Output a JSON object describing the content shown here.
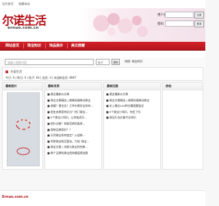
{
  "topbar": {
    "links": [
      "设为首页",
      "收藏本站"
    ]
  },
  "logo": {
    "title": "尔诺生活",
    "domain": "ernuo.com.cn"
  },
  "login": {
    "username_label": "用户名",
    "password_label": "密码",
    "register_label": "注册",
    "login_label": "登录"
  },
  "nav": {
    "items": [
      "网站首页",
      "珠宝知识",
      "饰品展示",
      "美文辞藏"
    ]
  },
  "search": {
    "placeholder": "请输入搜索内容",
    "scope": "帖子",
    "button": "搜索",
    "hot": "热搜: 珠宝知识"
  },
  "breadcrumb": {
    "current": "尔诺生活"
  },
  "stats": "今日: 0 | 昨日: 0 | 帖子: 64 | 会员: 3 | 欢迎新会员: 8967",
  "panels": {
    "latest_pics": "最新图片",
    "latest_posts": "最新发表",
    "latest_replies": "最新回复",
    "hot_posts": "热帖"
  },
  "latest_posts": [
    "■ 黄金最新价文章",
    "■ 珠宝文案精选 | 感情祝福律动珠宝",
    "■ 收藏？黄金金？王爷市黄珍宝如何...",
    "■ 银金卖哪家的好点？热门珠宝...",
    "■ 9个珠宝小知识，让你变成识...",
    "■ 银针试着？你能否辨别真贵...",
    "■ 银制品哪家好？？",
    "■ 天然珠宝如何鉴定？火烧辨...",
    "■ 考察珠宝购买要诀，为啥 '珠宝...",
    "■ 珠宝文案 | 诗意与珠宝的完美...",
    "■ 哪个品牌的珠宝首饰最值得信赖"
  ],
  "latest_replies": [
    "■ 黄金最新价文章",
    "■ 珠宝文案精选 | 感情祝福律动珠宝",
    "■ 史上最全100种古籍图题鉴定",
    "■ 9个珠宝小知识，你会了吗",
    "■ 珠宝行业必备专业知识"
  ],
  "footer": {
    "brand": "Ernuo.com.cn"
  },
  "colors": {
    "brand_red": "#b3141b",
    "nav_red": "#d4212a"
  }
}
